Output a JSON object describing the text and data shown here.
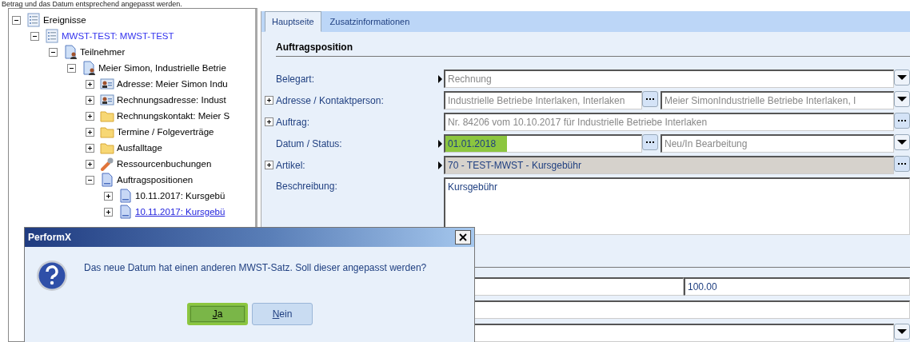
{
  "caption": "Betrag und das Datum entsprechend angepasst werden.",
  "tree": [
    {
      "label": "Ereignisse",
      "kind": "list",
      "expanded": true,
      "active": false,
      "selected": false,
      "children": [
        {
          "label": "MWST-TEST: MWST-TEST",
          "kind": "list",
          "expanded": true,
          "active": true,
          "selected": false,
          "children": [
            {
              "label": "Teilnehmer",
              "kind": "person",
              "expanded": true,
              "active": false,
              "selected": false,
              "children": [
                {
                  "label": "Meier Simon, Industrielle Betrie",
                  "kind": "person",
                  "expanded": true,
                  "active": false,
                  "selected": false,
                  "children": [
                    {
                      "label": "Adresse: Meier Simon Indu",
                      "kind": "card",
                      "expanded": false,
                      "active": false,
                      "selected": false
                    },
                    {
                      "label": "Rechnungsadresse: Indust",
                      "kind": "card",
                      "expanded": false,
                      "active": false,
                      "selected": false
                    },
                    {
                      "label": "Rechnungskontakt: Meier S",
                      "kind": "folder",
                      "expanded": false,
                      "active": false,
                      "selected": false
                    },
                    {
                      "label": "Termine / Folgeverträge",
                      "kind": "folder",
                      "expanded": false,
                      "active": false,
                      "selected": false
                    },
                    {
                      "label": "Ausfalltage",
                      "kind": "folder",
                      "expanded": false,
                      "active": false,
                      "selected": false
                    },
                    {
                      "label": "Ressourcenbuchungen",
                      "kind": "wrench",
                      "expanded": false,
                      "active": false,
                      "selected": false
                    },
                    {
                      "label": "Auftragspositionen",
                      "kind": "doc",
                      "expanded": true,
                      "active": false,
                      "selected": false,
                      "children": [
                        {
                          "label": "10.11.2017:  Kursgebü",
                          "kind": "doc",
                          "expanded": false,
                          "active": false,
                          "selected": false
                        },
                        {
                          "label": "10.11.2017:  Kursgebü",
                          "kind": "doc",
                          "expanded": false,
                          "active": false,
                          "selected": true
                        }
                      ]
                    }
                  ]
                }
              ]
            }
          ]
        }
      ]
    }
  ],
  "tabs": [
    {
      "label": "Hauptseite",
      "selected": true
    },
    {
      "label": "Zusatzinformationen",
      "selected": false
    }
  ],
  "section_title": "Auftragsposition",
  "rows": [
    {
      "label": "Belegart:",
      "plus": false,
      "marker": true,
      "fields": [
        {
          "kind": "dropdown",
          "value": "Rechnung",
          "disabled": true,
          "highlighted": false
        }
      ]
    },
    {
      "label": "Adresse / Kontaktperson:",
      "plus": true,
      "marker": false,
      "fields": [
        {
          "kind": "lookup",
          "value": "Industrielle Betriebe Interlaken, Interlaken",
          "disabled": true,
          "highlighted": false
        },
        {
          "kind": "dropdown",
          "value": "Meier SimonIndustrielle Betriebe Interlaken, I",
          "disabled": true,
          "highlighted": false
        }
      ]
    },
    {
      "label": "Auftrag:",
      "plus": true,
      "marker": false,
      "fields": [
        {
          "kind": "lookup",
          "value": "Nr. 84206 vom 10.10.2017 für Industrielle Betriebe Interlaken",
          "disabled": true,
          "highlighted": false
        }
      ]
    },
    {
      "label": "Datum / Status:",
      "plus": false,
      "marker": true,
      "fields": [
        {
          "kind": "lookup",
          "value": "01.01.2018",
          "disabled": false,
          "highlighted": true
        },
        {
          "kind": "dropdown",
          "value": "Neu/In Bearbeitung",
          "disabled": true,
          "highlighted": false
        }
      ]
    },
    {
      "label": "Artikel:",
      "plus": true,
      "marker": true,
      "fields": [
        {
          "kind": "lookup",
          "value": "70 - TEST-MWST - Kursgebühr",
          "disabled": false,
          "highlighted": false,
          "shaded": true
        }
      ]
    },
    {
      "label": "Beschreibung:",
      "plus": false,
      "marker": false,
      "fields": [
        {
          "kind": "textarea",
          "value": "Kursgebühr",
          "disabled": false,
          "highlighted": false
        }
      ]
    }
  ],
  "amount": "100.00",
  "dialog": {
    "title": "PerformX",
    "message": "Das neue Datum hat einen anderen MWST-Satz. Soll dieser angepasst werden?",
    "buttons": [
      {
        "label": "Ja",
        "selected": true
      },
      {
        "label": "Nein",
        "selected": false
      }
    ]
  }
}
